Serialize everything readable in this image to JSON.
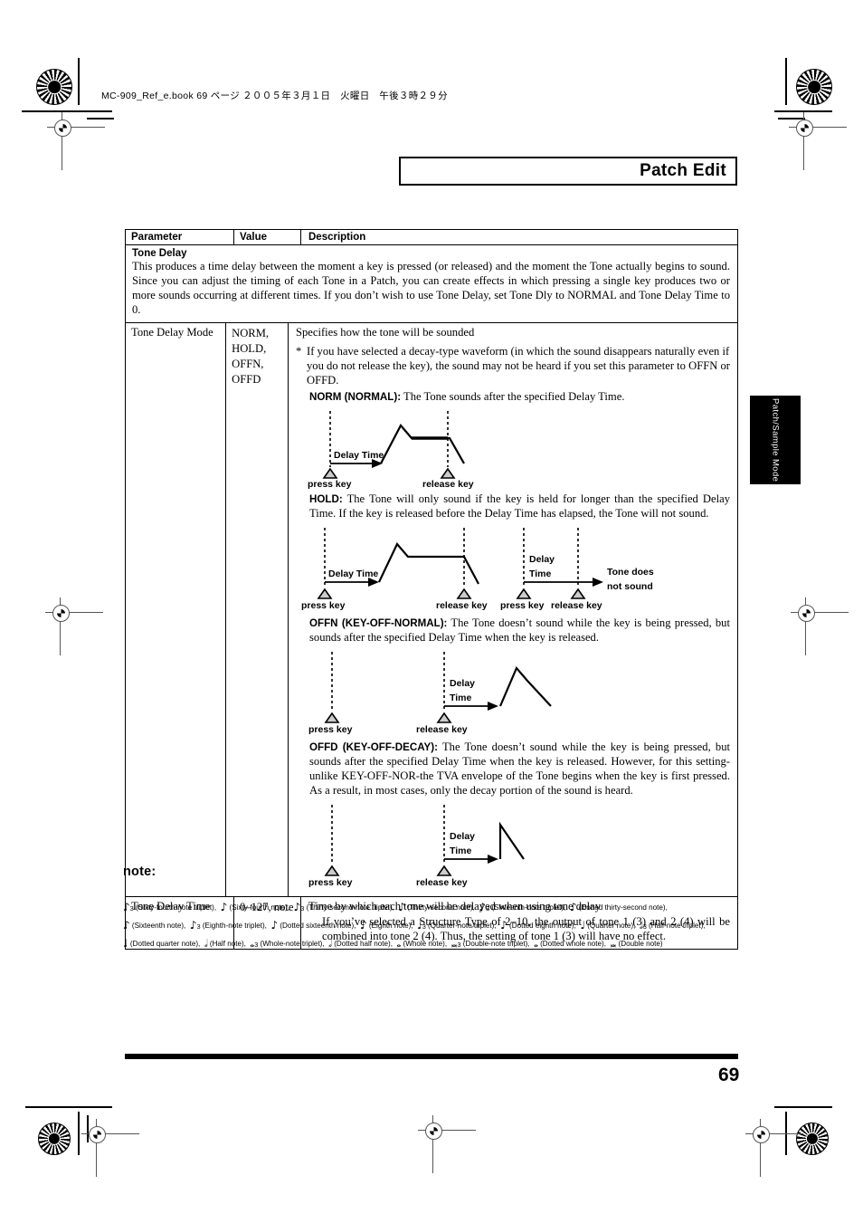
{
  "slug": "MC-909_Ref_e.book  69 ページ  ２００５年３月１日　火曜日　午後３時２９分",
  "running_head": "Patch Edit",
  "thumb_tab": "Patch/Sample Mode",
  "folio": "69",
  "table": {
    "headers": {
      "parameter": "Parameter",
      "value": "Value",
      "description": "Description"
    },
    "section": {
      "title": "Tone Delay",
      "text": "This produces a time delay between the moment a key is pressed (or released) and the moment the Tone actually begins to sound. Since you can adjust the timing of each Tone in a Patch, you can create effects in which pressing a single key produces two or more sounds occurring at different times. If you don’t wish to use Tone Delay, set Tone Dly to NORMAL and Tone Delay Time to 0."
    },
    "rows": [
      {
        "parameter": "Tone Delay Mode",
        "value": "NORM,\nHOLD,\nOFFN,\nOFFD",
        "desc_intro": "Specifies how the tone will be sounded",
        "bullet_star": "*",
        "bullet_text": "If you have selected a decay-type waveform (in which the sound disappears naturally even if you do not release the key), the sound may not be heard if you set this parameter to OFFN or OFFD.",
        "modes": [
          {
            "name": "NORM (NORMAL):",
            "text": " The Tone sounds after the specified Delay Time."
          },
          {
            "name": "HOLD:",
            "text": " The Tone will only sound if the key is held for longer than the specified Delay Time. If the key is released before the Delay Time has elapsed, the Tone will not sound."
          },
          {
            "name": "OFFN (KEY-OFF-NORMAL):",
            "text": " The Tone doesn’t sound while the key is being pressed, but sounds after the specified Delay Time when the key is released."
          },
          {
            "name": "OFFD (KEY-OFF-DECAY):",
            "text": " The Tone doesn’t sound while the key is being pressed, but sounds after the specified Delay Time when the key is released. However, for this setting-unlike KEY-OFF-NOR-the TVA envelope of the Tone begins when the key is first pressed. As a result, in most cases, only the decay portion of the sound is heard."
          }
        ]
      },
      {
        "parameter": "Tone Delay Time",
        "value": "0–127, note",
        "desc_intro": "Time by which each tone will be delayed when using tone delay",
        "desc_extra": "If you’ve selected a Structure Type of 2–10, the output of tone 1 (3) and 2 (4) will be combined into tone 2 (4). Thus, the setting of tone 1 (3) will have no effect."
      }
    ]
  },
  "figures": {
    "norm": {
      "delay_label": "Delay Time",
      "press_key": "press key",
      "release_key": "release key"
    },
    "hold": {
      "delay_label": "Delay Time",
      "delay_label_2_line1": "Delay",
      "delay_label_2_line2": "Time",
      "press_key": "press key",
      "release_key": "release key",
      "press_key_2": "press key",
      "release_key_2": "release key",
      "no_sound_line1": "Tone does",
      "no_sound_line2": "not sound"
    },
    "offn": {
      "delay_label_line1": "Delay",
      "delay_label_line2": "Time",
      "press_key": "press key",
      "release_key": "release key"
    },
    "offd": {
      "delay_label_line1": "Delay",
      "delay_label_line2": "Time",
      "press_key": "press key",
      "release_key": "release key"
    }
  },
  "note": {
    "heading": "note:",
    "lines": [
      [
        {
          "glyph": "♪",
          "sub": "3",
          "text": "(Sixty-fourth-note triplet),"
        },
        {
          "glyph": "♪",
          "sub": "",
          "text": "(Sixty-fourth note),"
        },
        {
          "glyph": "♪",
          "sub": "3",
          "text": "(Thirty-second-note triplet),"
        },
        {
          "glyph": "♪",
          "sub": "",
          "text": "(Thirty-second note),"
        },
        {
          "glyph": "♪",
          "sub": "3",
          "text": "(Sixteenth-note triplet),"
        },
        {
          "glyph": "♪",
          "sub": "",
          "text": "(Dotted thirty-second note),"
        }
      ],
      [
        {
          "glyph": "♪",
          "sub": "",
          "text": "(Sixteenth note),"
        },
        {
          "glyph": "♪",
          "sub": "3",
          "text": "(Eighth-note triplet),"
        },
        {
          "glyph": "♪",
          "sub": "",
          "text": "(Dotted sixteenth note),"
        },
        {
          "glyph": "♪",
          "sub": "",
          "text": "(Eighth note),"
        },
        {
          "glyph": "♩",
          "sub": "3",
          "text": "(Quarter-note triplet),"
        },
        {
          "glyph": "♪",
          "sub": "",
          "text": "(Dotted eighth note),"
        },
        {
          "glyph": "♩",
          "sub": "",
          "text": "(Quarter note),"
        },
        {
          "glyph": "𝅗𝅥",
          "sub": "3",
          "text": "(Half-note triplet),"
        }
      ],
      [
        {
          "glyph": "♩",
          "sub": "",
          "text": "(Dotted quarter note),"
        },
        {
          "glyph": "𝅗𝅥",
          "sub": "",
          "text": "(Half note),"
        },
        {
          "glyph": "𝅝",
          "sub": "3",
          "text": "(Whole-note triplet),"
        },
        {
          "glyph": "𝅗𝅥",
          "sub": "",
          "text": "(Dotted half note),"
        },
        {
          "glyph": "𝅝",
          "sub": "",
          "text": "(Whole note),"
        },
        {
          "glyph": "𝅜",
          "sub": "3",
          "text": "(Double-note triplet),"
        },
        {
          "glyph": "𝅝",
          "sub": "",
          "text": "(Dotted whole note),"
        },
        {
          "glyph": "𝅜",
          "sub": "",
          "text": "(Double note)"
        }
      ]
    ]
  }
}
